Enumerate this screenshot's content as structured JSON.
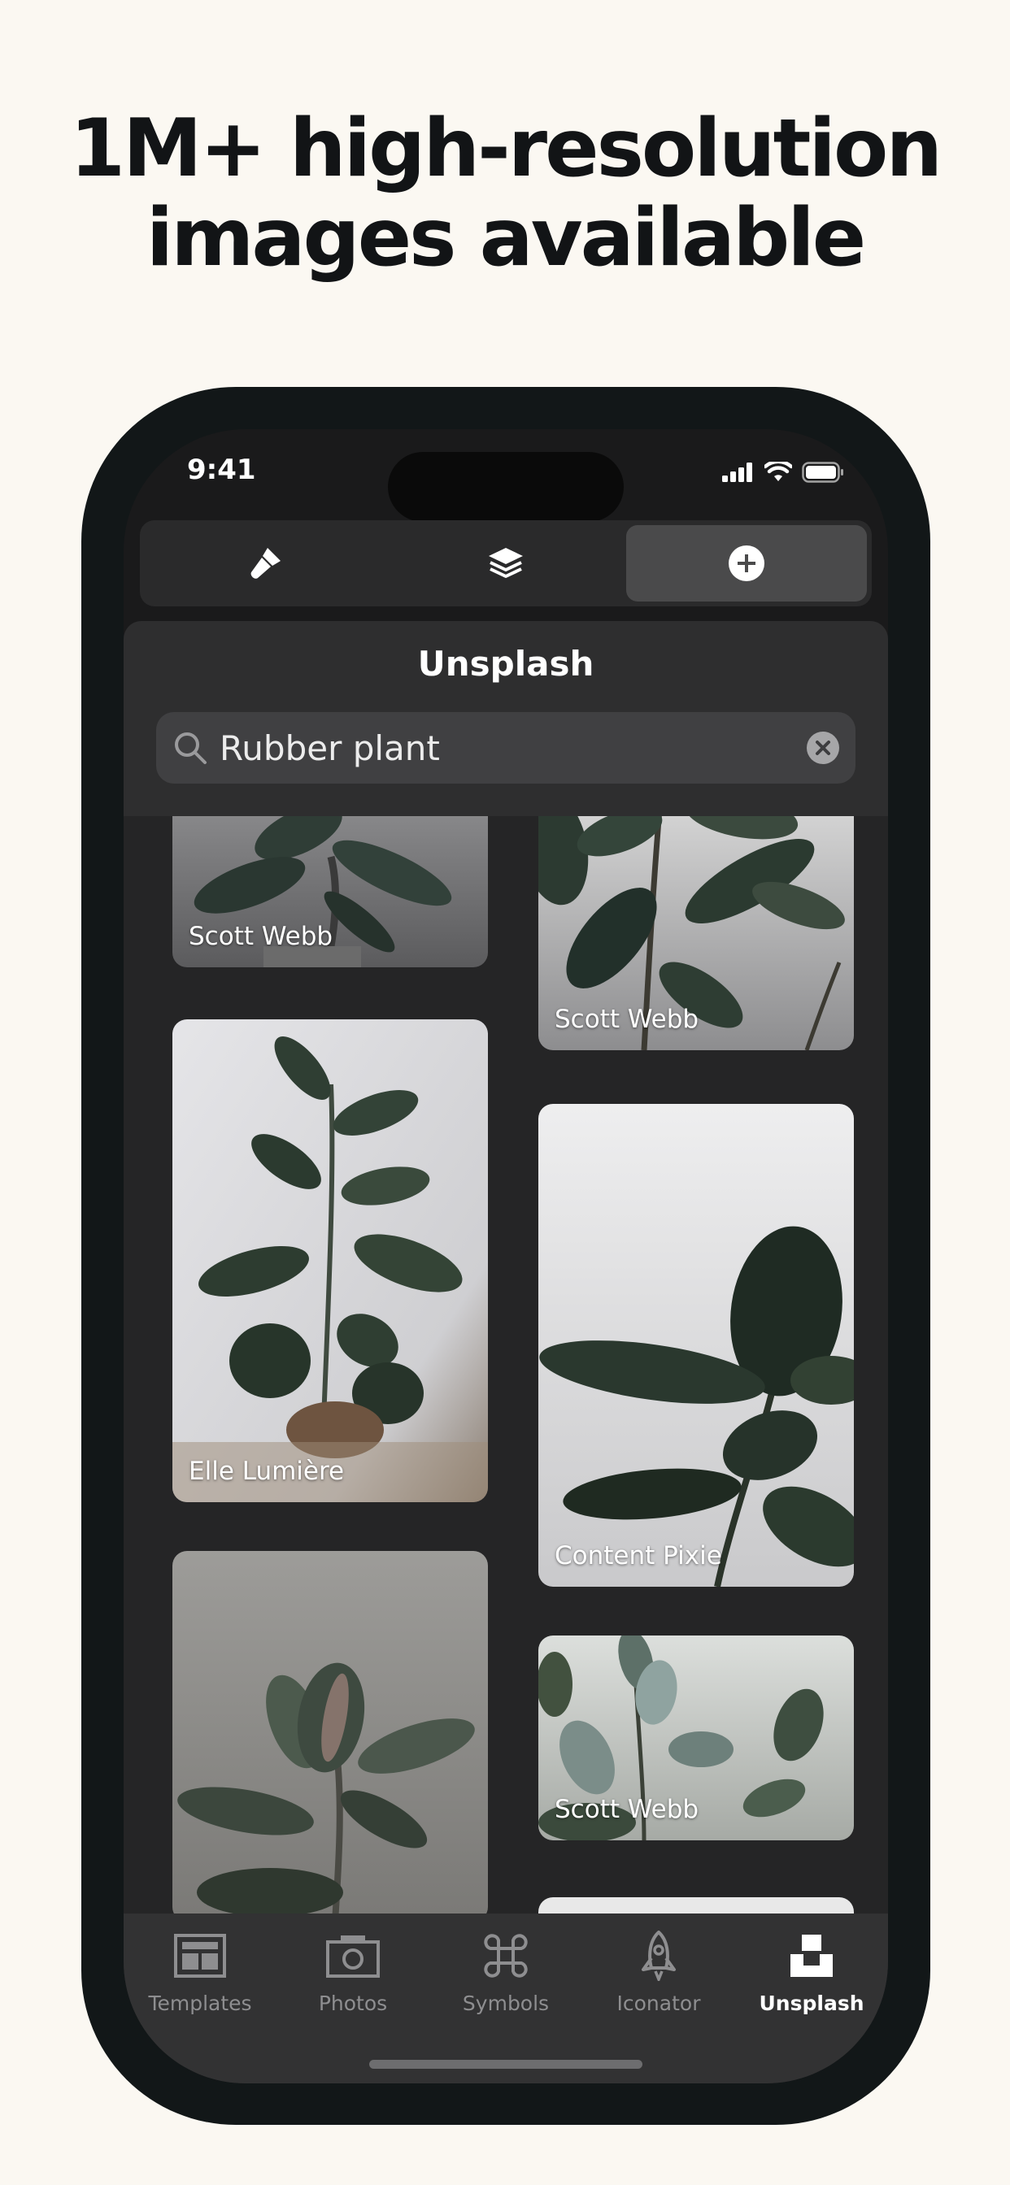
{
  "headline": {
    "line1": "1M+ high-resolution",
    "line2": "images available"
  },
  "status_bar": {
    "time": "9:41"
  },
  "segmented_control": {
    "items": [
      {
        "icon": "brush-icon",
        "selected": false
      },
      {
        "icon": "layers-icon",
        "selected": false
      },
      {
        "icon": "plus-circle-icon",
        "selected": true
      }
    ]
  },
  "sheet": {
    "title": "Unsplash",
    "search": {
      "value": "Rubber plant",
      "placeholder": "Search"
    }
  },
  "photos": {
    "left": [
      {
        "author": "Scott Webb"
      },
      {
        "author": "Elle Lumière"
      },
      {
        "author": ""
      }
    ],
    "right": [
      {
        "author": "Scott Webb"
      },
      {
        "author": "Content Pixie"
      },
      {
        "author": "Scott Webb"
      }
    ]
  },
  "tab_bar": {
    "tabs": [
      {
        "label": "Templates",
        "icon": "templates-icon"
      },
      {
        "label": "Photos",
        "icon": "camera-icon"
      },
      {
        "label": "Symbols",
        "icon": "command-icon"
      },
      {
        "label": "Iconator",
        "icon": "rocket-icon"
      },
      {
        "label": "Unsplash",
        "icon": "unsplash-icon"
      }
    ],
    "active": "Unsplash"
  },
  "colors": {
    "background": "#fbf8f2",
    "phone": "#121718",
    "sheet": "#252526",
    "accent_active": "#ffffff"
  }
}
